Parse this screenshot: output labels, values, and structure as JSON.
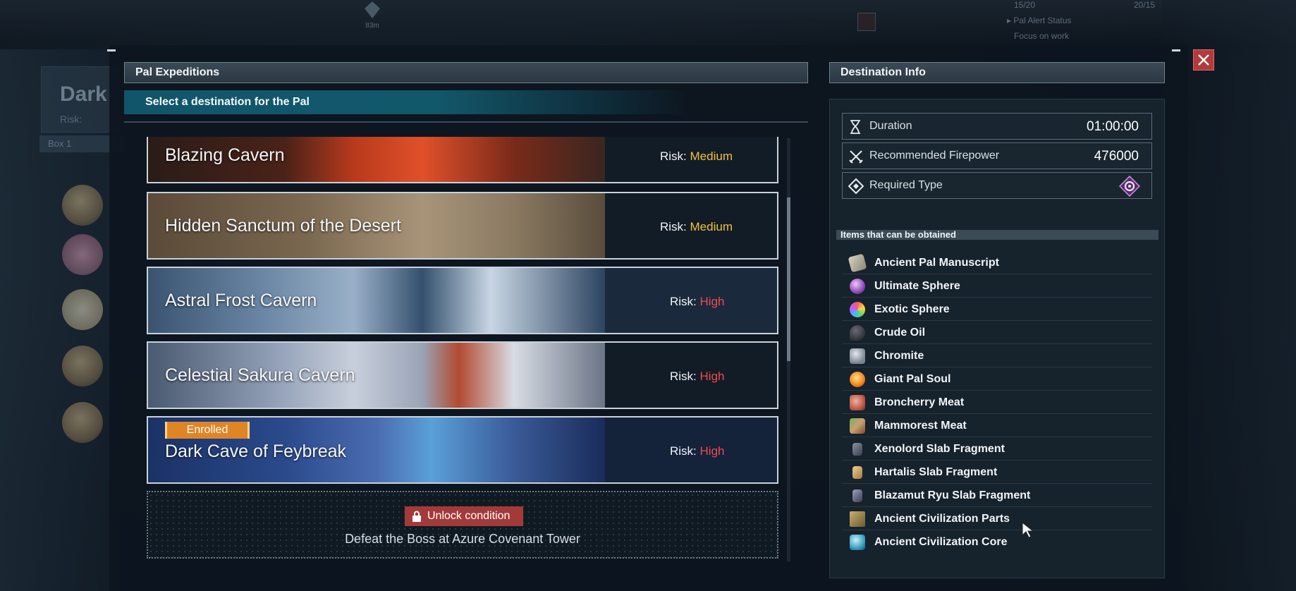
{
  "background": {
    "left_title": "Dark",
    "left_subtitle": "Risk:",
    "box_label": "Box 1",
    "status_count_a": "15/20",
    "status_count_b": "20/15",
    "status_line_1": "▸ Pal Alert Status",
    "status_line_2": "Focus on work",
    "distance": "83m"
  },
  "left_panel": {
    "title": "Pal Expeditions",
    "subtitle": "Select a destination for the Pal",
    "risk_label": "Risk:",
    "destinations": [
      {
        "name": "Blazing Cavern",
        "risk": "Medium"
      },
      {
        "name": "Hidden Sanctum of the Desert",
        "risk": "Medium"
      },
      {
        "name": "Astral Frost Cavern",
        "risk": "High"
      },
      {
        "name": "Celestial Sakura Cavern",
        "risk": "High"
      },
      {
        "name": "Dark Cave of Feybreak",
        "risk": "High",
        "badge": "Enrolled"
      }
    ],
    "locked": {
      "badge": "Unlock condition",
      "text": "Defeat the Boss at Azure Covenant Tower"
    }
  },
  "right_panel": {
    "title": "Destination Info",
    "duration_label": "Duration",
    "duration_value": "01:00:00",
    "firepower_label": "Recommended Firepower",
    "firepower_value": "476000",
    "type_label": "Required Type",
    "type_icon": "dark-element-icon",
    "items_header": "Items that can be obtained",
    "items": [
      "Ancient Pal Manuscript",
      "Ultimate Sphere",
      "Exotic Sphere",
      "Crude Oil",
      "Chromite",
      "Giant Pal Soul",
      "Broncherry Meat",
      "Mammorest Meat",
      "Xenolord Slab Fragment",
      "Hartalis Slab Fragment",
      "Blazamut Ryu Slab Fragment",
      "Ancient Civilization Parts",
      "Ancient Civilization Core"
    ]
  },
  "colors": {
    "risk_medium": "#f0c040",
    "risk_high": "#ef4b4b",
    "enrolled": "#e08526",
    "unlock": "#a33a3a",
    "close": "#b23a3a"
  }
}
